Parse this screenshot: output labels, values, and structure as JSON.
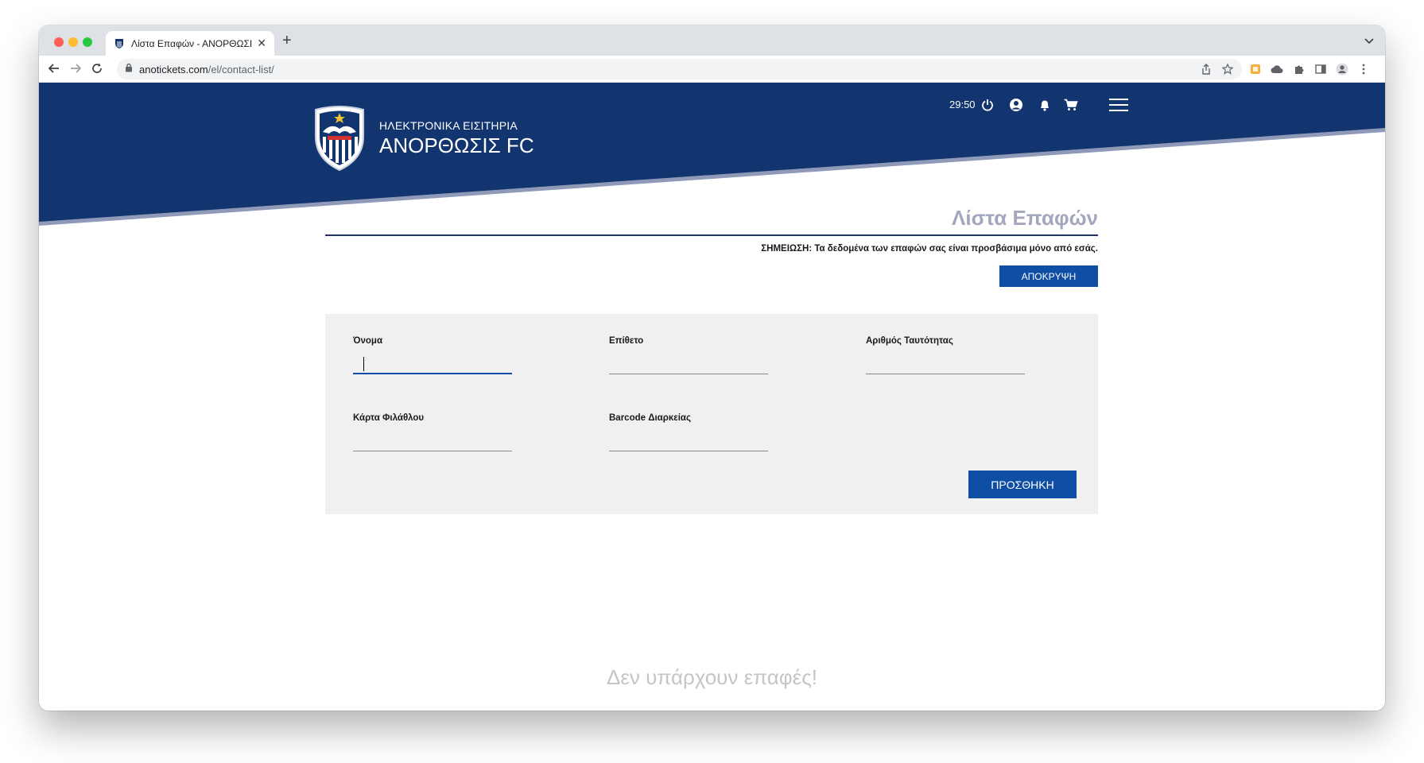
{
  "browser": {
    "tab_title": "Λίστα Επαφών - ΑΝΟΡΘΩΣΙΣ F",
    "new_tab_symbol": "+",
    "close_symbol": "✕",
    "url_domain": "anotickets.com",
    "url_path": "/el/contact-list/"
  },
  "header": {
    "brand_subtitle": "ΗΛΕΚΤΡΟΝΙΚΑ ΕΙΣΙΤΗΡΙΑ",
    "brand_title": "ΑΝΟΡΘΩΣΙΣ FC",
    "timer": "29:50",
    "icons": [
      "power-icon",
      "user-circle-icon",
      "bell-icon",
      "cart-icon",
      "menu-icon"
    ],
    "colors": {
      "primary": "#12346f",
      "accent": "#8e9ab8"
    }
  },
  "main": {
    "heading": "Λίστα Επαφών",
    "note": "ΣΗΜΕΙΩΣΗ: Τα δεδομένα των επαφών σας είναι προσβάσιμα μόνο από εσάς.",
    "hide_button": "ΑΠΟΚΡΥΨΗ",
    "form": {
      "first_name_label": "Όνομα",
      "last_name_label": "Επίθετο",
      "id_number_label": "Αριθμός Ταυτότητας",
      "fan_card_label": "Κάρτα Φιλάθλου",
      "season_barcode_label": "Barcode Διαρκείας",
      "first_name_value": "",
      "last_name_value": "",
      "id_number_value": "",
      "fan_card_value": "",
      "season_barcode_value": ""
    },
    "add_button": "ΠΡΟΣΘΗΚΗ",
    "empty_message": "Δεν υπάρχουν επαφές!"
  }
}
